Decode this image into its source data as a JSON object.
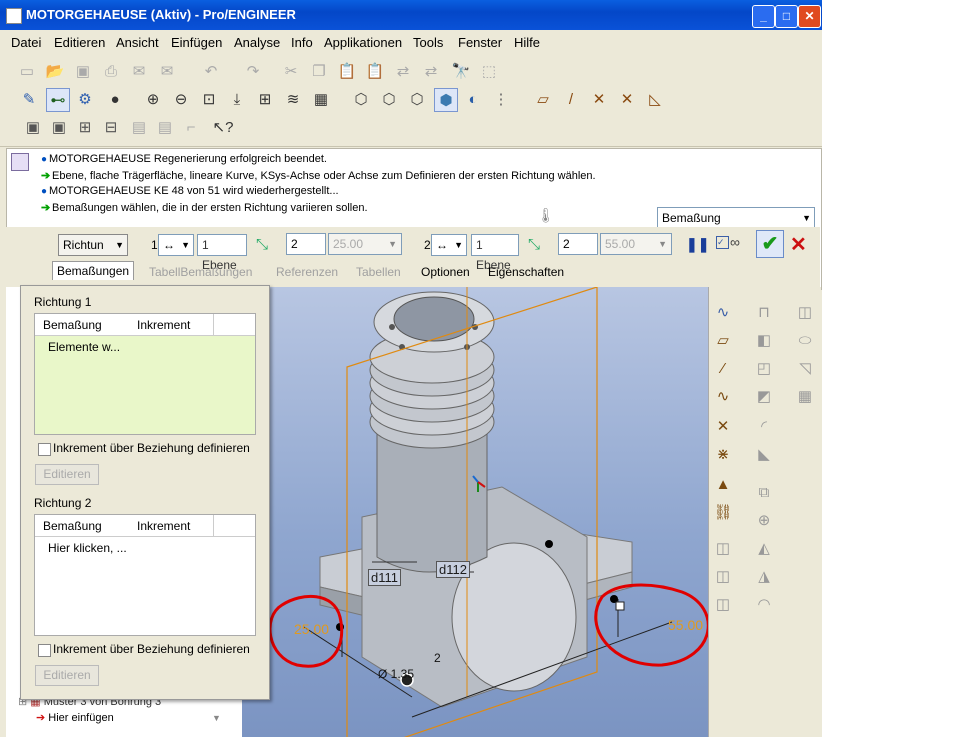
{
  "window": {
    "title": "MOTORGEHAEUSE (Aktiv) - Pro/ENGINEER"
  },
  "menu": [
    "Datei",
    "Editieren",
    "Ansicht",
    "Einfügen",
    "Analyse",
    "Info",
    "Applikationen",
    "Tools",
    "Fenster",
    "Hilfe"
  ],
  "messages": [
    {
      "icon": "bullet",
      "text": "MOTORGEHAEUSE Regenerierung erfolgreich beendet."
    },
    {
      "icon": "arrow",
      "text": "Ebene, flache Trägerfläche, lineare Kurve, KSys-Achse oder Achse zum Definieren der ersten Richtung wählen."
    },
    {
      "icon": "bullet",
      "text": "MOTORGEHAEUSE KE 48 von 51 wird wiederhergestellt..."
    },
    {
      "icon": "arrow",
      "text": "Bemaßungen wählen, die in der ersten Richtung variieren sollen."
    }
  ],
  "dashboard": {
    "filter_select": "Bemaßung",
    "type_select": "Richtun",
    "dir1_label": "1",
    "dir1_plane": "1 Ebene",
    "dir1_count": "2",
    "dir1_increment": "25.00",
    "dir2_label": "2",
    "dir2_plane": "1 Ebene",
    "dir2_count": "2",
    "dir2_increment": "55.00",
    "tabs": [
      "Bemaßungen",
      "TabellBemaßungen",
      "Referenzen",
      "Tabellen",
      "Optionen",
      "Eigenschaften"
    ]
  },
  "panel": {
    "dir1_title": "Richtung 1",
    "dir2_title": "Richtung 2",
    "col_dim": "Bemaßung",
    "col_inc": "Inkrement",
    "dir1_row": "Elemente w...",
    "dir2_row": "Hier klicken, ...",
    "checkbox_label": "Inkrement über Beziehung definieren",
    "edit_button": "Editieren"
  },
  "tree": {
    "item1": "Muster 3 von Bohrung 3",
    "item2": "Hier einfügen"
  },
  "annotations": {
    "d111": "d111",
    "d112": "d112",
    "val25": "25.00",
    "val55": "55.00",
    "dim2": "2",
    "diam": "Ø 1.35"
  },
  "colors": {
    "accent_selected": "#e9f7c9",
    "annotation": "#e09a20",
    "highlight_ring": "#e00000"
  }
}
